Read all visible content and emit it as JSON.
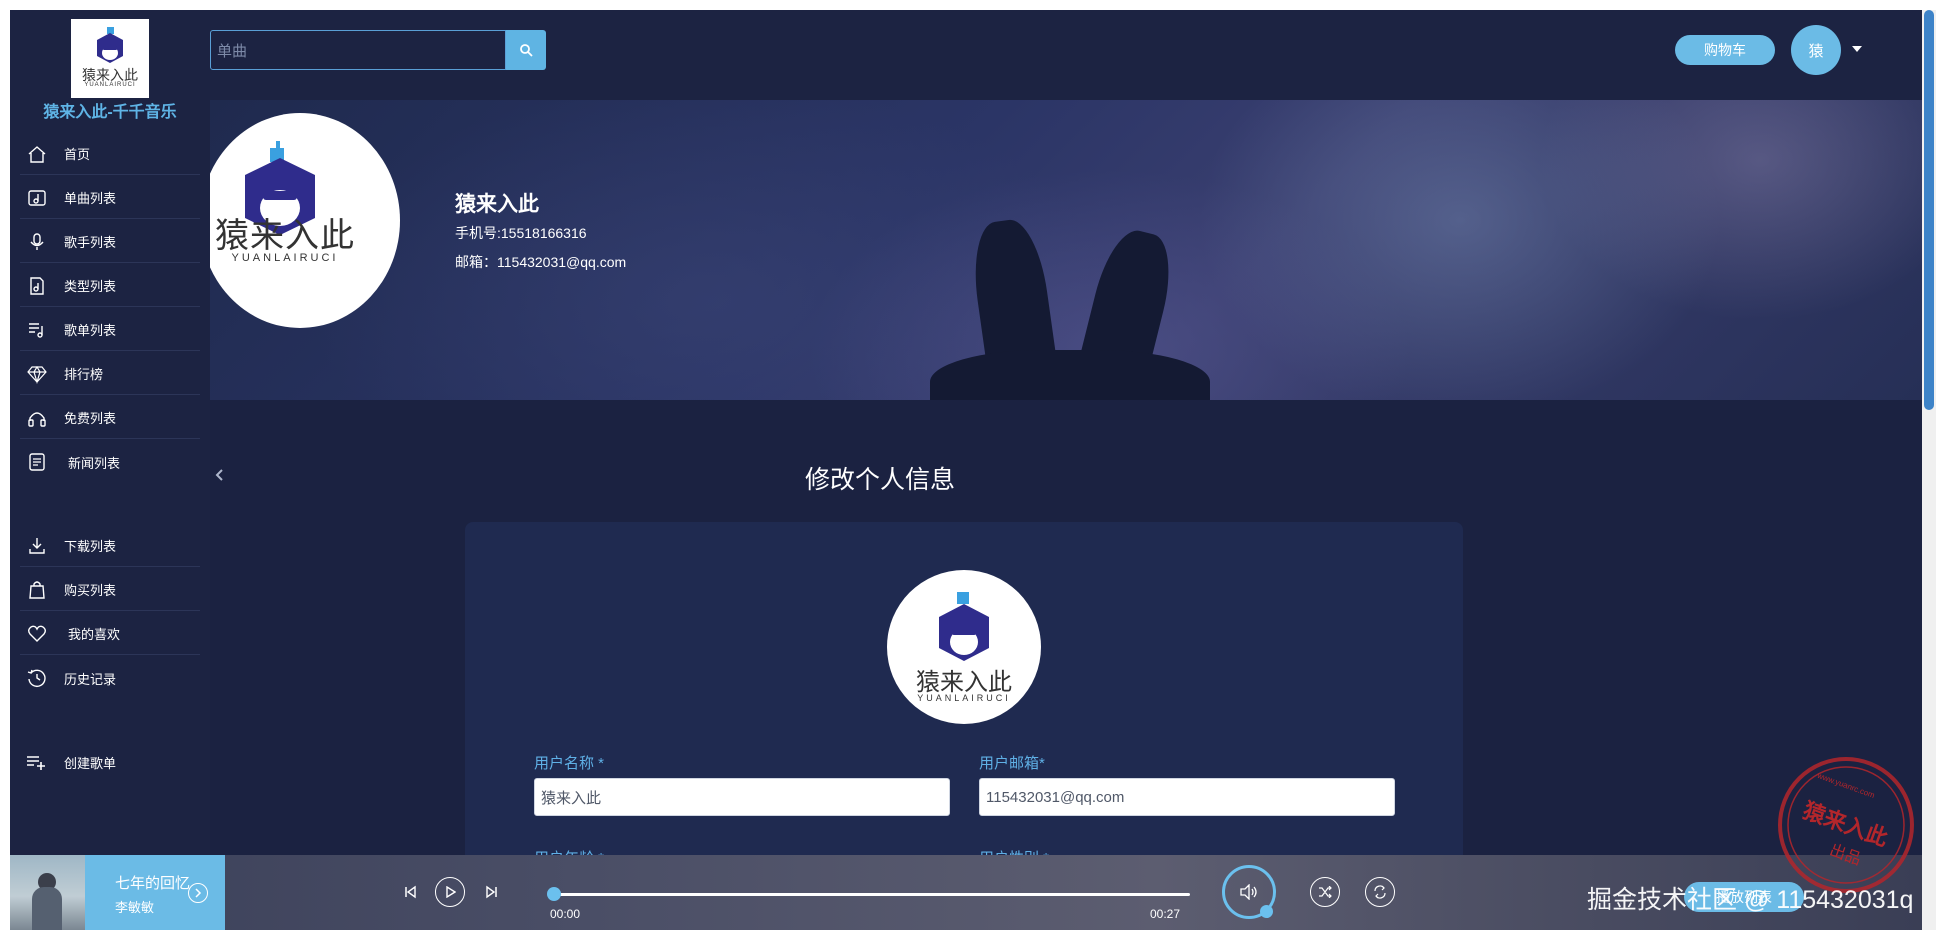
{
  "site": {
    "logo_text": "猿来入此",
    "logo_subtext": "YUANLAIRUCI",
    "title": "猿来入此-千千音乐"
  },
  "header": {
    "search_placeholder": "单曲",
    "cart_label": "购物车",
    "avatar_label": "猿"
  },
  "sidebar": {
    "items": [
      {
        "label": "首页",
        "icon": "home-icon"
      },
      {
        "label": "单曲列表",
        "icon": "music-note-icon"
      },
      {
        "label": "歌手列表",
        "icon": "microphone-icon"
      },
      {
        "label": "类型列表",
        "icon": "music-file-icon"
      },
      {
        "label": "歌单列表",
        "icon": "playlist-icon"
      },
      {
        "label": "排行榜",
        "icon": "diamond-icon"
      },
      {
        "label": "免费列表",
        "icon": "headphones-icon"
      },
      {
        "label": "新闻列表",
        "icon": "news-icon"
      },
      {
        "label": "下载列表",
        "icon": "download-icon"
      },
      {
        "label": "购买列表",
        "icon": "shopping-bag-icon"
      },
      {
        "label": "我的喜欢",
        "icon": "heart-icon"
      },
      {
        "label": "历史记录",
        "icon": "history-icon"
      },
      {
        "label": "创建歌单",
        "icon": "add-playlist-icon"
      }
    ]
  },
  "profile": {
    "name": "猿来入此",
    "phone": "手机号:15518166316",
    "email": "邮箱：115432031@qq.com"
  },
  "form": {
    "title": "修改个人信息",
    "username_label": "用户名称 *",
    "username_value": "猿来入此",
    "email_label": "用户邮箱*",
    "email_value": "115432031@qq.com",
    "age_label": "用户年龄 *",
    "gender_label": "用户性别 *"
  },
  "player": {
    "song_title": "七年的回忆",
    "artist": "李敏敏",
    "current_time": "00:00",
    "total_time": "00:27",
    "progress": 0,
    "playlist_label": "播放列表"
  },
  "watermark": {
    "text": "掘金技术社区 @ 115432031q",
    "stamp_text": "猿来入此",
    "stamp_sub": "出品",
    "stamp_url": "www.yuanrc.com"
  },
  "colors": {
    "accent": "#6bbbe6",
    "background": "#1a2140",
    "label": "#5fb0e6"
  }
}
